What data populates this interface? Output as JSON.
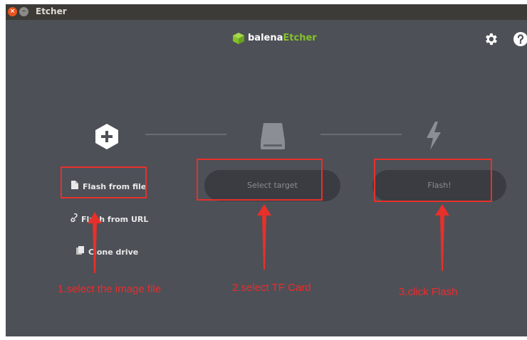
{
  "window": {
    "title": "Etcher",
    "close_glyph": "×",
    "minimize_glyph": "–"
  },
  "logo": {
    "brand": "balena",
    "product": "Etcher",
    "product_color": "#85c12a"
  },
  "header": {
    "settings_icon": "gear-icon",
    "help_icon": "help-icon"
  },
  "steps": {
    "image": {
      "icon": "plus-hexagon-icon",
      "options": [
        {
          "label": "Flash from file",
          "icon": "file-icon"
        },
        {
          "label": "Flash from URL",
          "icon": "link-icon"
        },
        {
          "label": "Clone drive",
          "icon": "copy-icon"
        }
      ]
    },
    "target": {
      "icon": "drive-icon",
      "button_label": "Select target"
    },
    "flash": {
      "icon": "lightning-icon",
      "button_label": "Flash!"
    }
  },
  "annotations": {
    "step1": "1.select the image file",
    "step2": "2.select TF Card",
    "step3": "3.click Flash",
    "color": "#e8302a"
  }
}
